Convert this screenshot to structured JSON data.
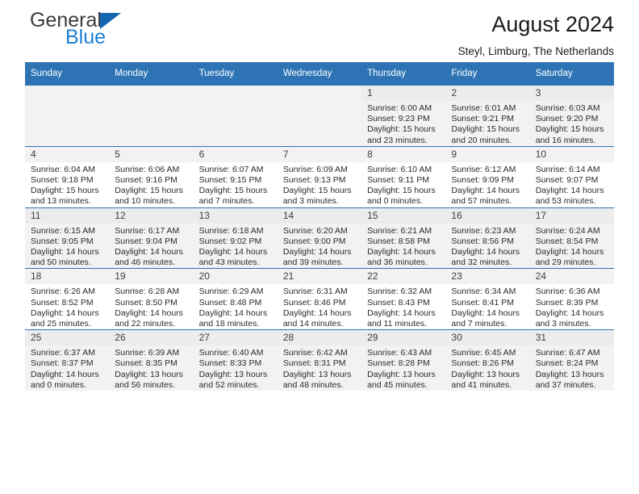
{
  "brand": {
    "name_part1": "General",
    "name_part2": "Blue",
    "triangle_color": "#1566b0",
    "blue_color": "#1e7fd4"
  },
  "header": {
    "title": "August 2024",
    "subtitle": "Steyl, Limburg, The Netherlands"
  },
  "theme": {
    "header_row_bg": "#2e74b5",
    "header_row_text": "#ffffff",
    "shaded_row_bg": "#f2f2f2",
    "daynum_bg": "#ececec"
  },
  "weekdays": [
    "Sunday",
    "Monday",
    "Tuesday",
    "Wednesday",
    "Thursday",
    "Friday",
    "Saturday"
  ],
  "labels": {
    "sunrise_prefix": "Sunrise: ",
    "sunset_prefix": "Sunset: ",
    "daylight_prefix": "Daylight: "
  },
  "weeks": [
    {
      "shaded": true,
      "days": [
        {
          "empty": true
        },
        {
          "empty": true
        },
        {
          "empty": true
        },
        {
          "empty": true
        },
        {
          "day": "1",
          "sunrise": "Sunrise: 6:00 AM",
          "sunset": "Sunset: 9:23 PM",
          "daylight": "Daylight: 15 hours and 23 minutes."
        },
        {
          "day": "2",
          "sunrise": "Sunrise: 6:01 AM",
          "sunset": "Sunset: 9:21 PM",
          "daylight": "Daylight: 15 hours and 20 minutes."
        },
        {
          "day": "3",
          "sunrise": "Sunrise: 6:03 AM",
          "sunset": "Sunset: 9:20 PM",
          "daylight": "Daylight: 15 hours and 16 minutes."
        }
      ]
    },
    {
      "shaded": false,
      "days": [
        {
          "day": "4",
          "sunrise": "Sunrise: 6:04 AM",
          "sunset": "Sunset: 9:18 PM",
          "daylight": "Daylight: 15 hours and 13 minutes."
        },
        {
          "day": "5",
          "sunrise": "Sunrise: 6:06 AM",
          "sunset": "Sunset: 9:16 PM",
          "daylight": "Daylight: 15 hours and 10 minutes."
        },
        {
          "day": "6",
          "sunrise": "Sunrise: 6:07 AM",
          "sunset": "Sunset: 9:15 PM",
          "daylight": "Daylight: 15 hours and 7 minutes."
        },
        {
          "day": "7",
          "sunrise": "Sunrise: 6:09 AM",
          "sunset": "Sunset: 9:13 PM",
          "daylight": "Daylight: 15 hours and 3 minutes."
        },
        {
          "day": "8",
          "sunrise": "Sunrise: 6:10 AM",
          "sunset": "Sunset: 9:11 PM",
          "daylight": "Daylight: 15 hours and 0 minutes."
        },
        {
          "day": "9",
          "sunrise": "Sunrise: 6:12 AM",
          "sunset": "Sunset: 9:09 PM",
          "daylight": "Daylight: 14 hours and 57 minutes."
        },
        {
          "day": "10",
          "sunrise": "Sunrise: 6:14 AM",
          "sunset": "Sunset: 9:07 PM",
          "daylight": "Daylight: 14 hours and 53 minutes."
        }
      ]
    },
    {
      "shaded": true,
      "days": [
        {
          "day": "11",
          "sunrise": "Sunrise: 6:15 AM",
          "sunset": "Sunset: 9:05 PM",
          "daylight": "Daylight: 14 hours and 50 minutes."
        },
        {
          "day": "12",
          "sunrise": "Sunrise: 6:17 AM",
          "sunset": "Sunset: 9:04 PM",
          "daylight": "Daylight: 14 hours and 46 minutes."
        },
        {
          "day": "13",
          "sunrise": "Sunrise: 6:18 AM",
          "sunset": "Sunset: 9:02 PM",
          "daylight": "Daylight: 14 hours and 43 minutes."
        },
        {
          "day": "14",
          "sunrise": "Sunrise: 6:20 AM",
          "sunset": "Sunset: 9:00 PM",
          "daylight": "Daylight: 14 hours and 39 minutes."
        },
        {
          "day": "15",
          "sunrise": "Sunrise: 6:21 AM",
          "sunset": "Sunset: 8:58 PM",
          "daylight": "Daylight: 14 hours and 36 minutes."
        },
        {
          "day": "16",
          "sunrise": "Sunrise: 6:23 AM",
          "sunset": "Sunset: 8:56 PM",
          "daylight": "Daylight: 14 hours and 32 minutes."
        },
        {
          "day": "17",
          "sunrise": "Sunrise: 6:24 AM",
          "sunset": "Sunset: 8:54 PM",
          "daylight": "Daylight: 14 hours and 29 minutes."
        }
      ]
    },
    {
      "shaded": false,
      "days": [
        {
          "day": "18",
          "sunrise": "Sunrise: 6:26 AM",
          "sunset": "Sunset: 8:52 PM",
          "daylight": "Daylight: 14 hours and 25 minutes."
        },
        {
          "day": "19",
          "sunrise": "Sunrise: 6:28 AM",
          "sunset": "Sunset: 8:50 PM",
          "daylight": "Daylight: 14 hours and 22 minutes."
        },
        {
          "day": "20",
          "sunrise": "Sunrise: 6:29 AM",
          "sunset": "Sunset: 8:48 PM",
          "daylight": "Daylight: 14 hours and 18 minutes."
        },
        {
          "day": "21",
          "sunrise": "Sunrise: 6:31 AM",
          "sunset": "Sunset: 8:46 PM",
          "daylight": "Daylight: 14 hours and 14 minutes."
        },
        {
          "day": "22",
          "sunrise": "Sunrise: 6:32 AM",
          "sunset": "Sunset: 8:43 PM",
          "daylight": "Daylight: 14 hours and 11 minutes."
        },
        {
          "day": "23",
          "sunrise": "Sunrise: 6:34 AM",
          "sunset": "Sunset: 8:41 PM",
          "daylight": "Daylight: 14 hours and 7 minutes."
        },
        {
          "day": "24",
          "sunrise": "Sunrise: 6:36 AM",
          "sunset": "Sunset: 8:39 PM",
          "daylight": "Daylight: 14 hours and 3 minutes."
        }
      ]
    },
    {
      "shaded": true,
      "days": [
        {
          "day": "25",
          "sunrise": "Sunrise: 6:37 AM",
          "sunset": "Sunset: 8:37 PM",
          "daylight": "Daylight: 14 hours and 0 minutes."
        },
        {
          "day": "26",
          "sunrise": "Sunrise: 6:39 AM",
          "sunset": "Sunset: 8:35 PM",
          "daylight": "Daylight: 13 hours and 56 minutes."
        },
        {
          "day": "27",
          "sunrise": "Sunrise: 6:40 AM",
          "sunset": "Sunset: 8:33 PM",
          "daylight": "Daylight: 13 hours and 52 minutes."
        },
        {
          "day": "28",
          "sunrise": "Sunrise: 6:42 AM",
          "sunset": "Sunset: 8:31 PM",
          "daylight": "Daylight: 13 hours and 48 minutes."
        },
        {
          "day": "29",
          "sunrise": "Sunrise: 6:43 AM",
          "sunset": "Sunset: 8:28 PM",
          "daylight": "Daylight: 13 hours and 45 minutes."
        },
        {
          "day": "30",
          "sunrise": "Sunrise: 6:45 AM",
          "sunset": "Sunset: 8:26 PM",
          "daylight": "Daylight: 13 hours and 41 minutes."
        },
        {
          "day": "31",
          "sunrise": "Sunrise: 6:47 AM",
          "sunset": "Sunset: 8:24 PM",
          "daylight": "Daylight: 13 hours and 37 minutes."
        }
      ]
    }
  ]
}
